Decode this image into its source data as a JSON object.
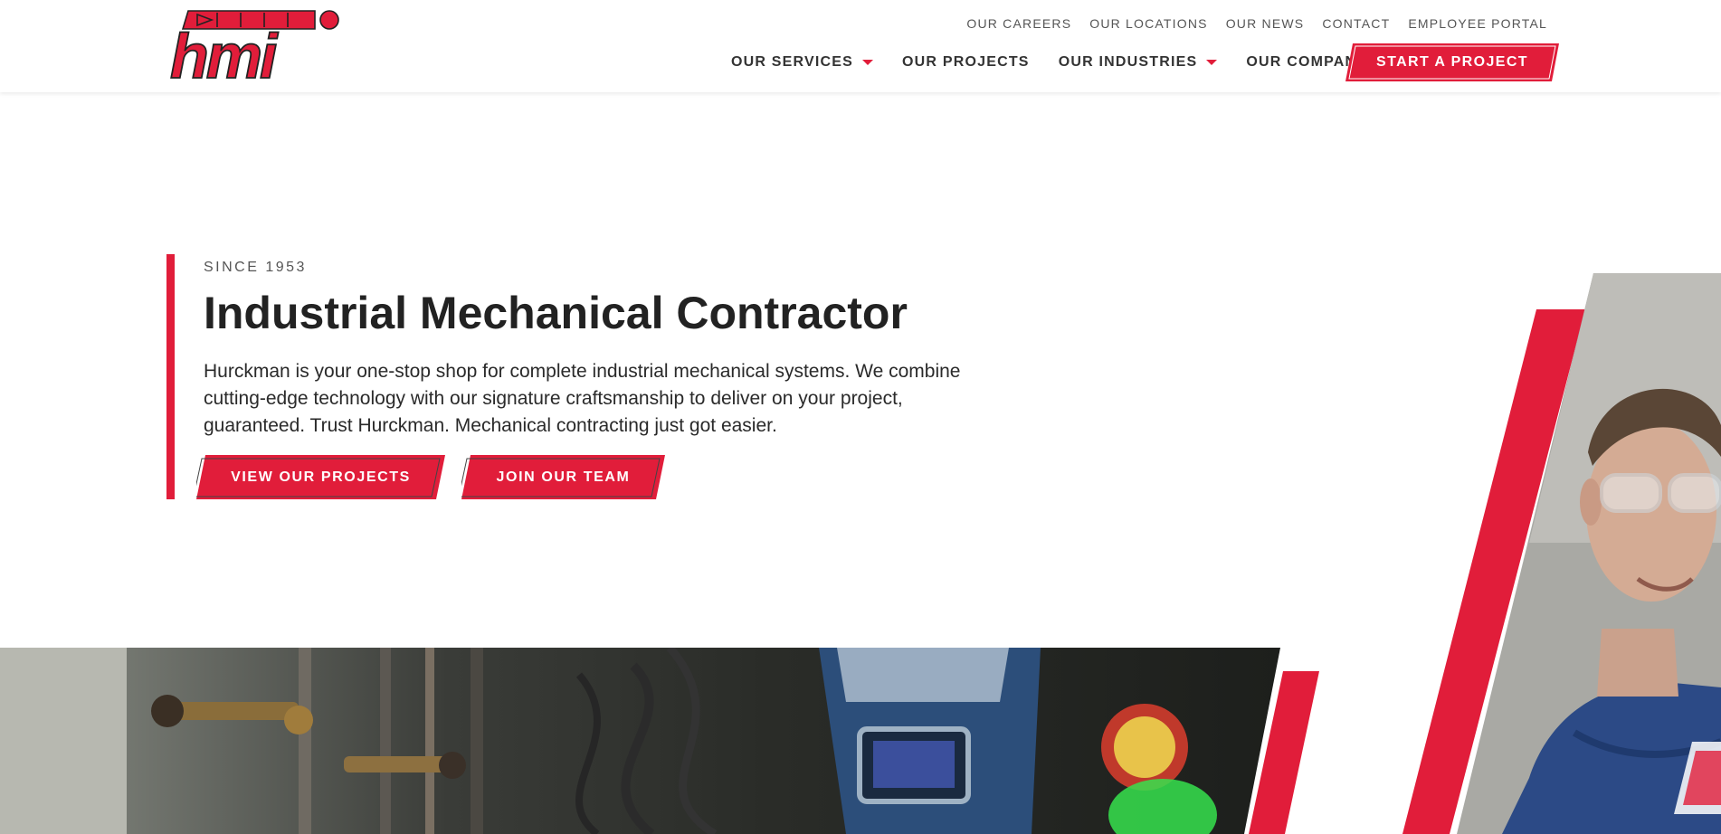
{
  "brand": {
    "logo_text": "hmi",
    "accent_color": "#e11d3a"
  },
  "utility_nav": [
    "OUR CAREERS",
    "OUR LOCATIONS",
    "OUR NEWS",
    "CONTACT",
    "EMPLOYEE PORTAL"
  ],
  "main_nav": [
    {
      "label": "OUR SERVICES",
      "has_dropdown": true
    },
    {
      "label": "OUR PROJECTS",
      "has_dropdown": false
    },
    {
      "label": "OUR INDUSTRIES",
      "has_dropdown": true
    },
    {
      "label": "OUR COMPANY",
      "has_dropdown": true
    }
  ],
  "cta_label": "START A PROJECT",
  "hero": {
    "kicker": "SINCE 1953",
    "title": "Industrial Mechanical Contractor",
    "description": "Hurckman is your one-stop shop for complete industrial mechanical systems. We combine cutting-edge technology with our signature craftsmanship to deliver on your project, guaranteed. Trust Hurckman. Mechanical contracting just got easier.",
    "buttons": {
      "primary": "VIEW OUR PROJECTS",
      "secondary": "JOIN OUR TEAM"
    }
  }
}
